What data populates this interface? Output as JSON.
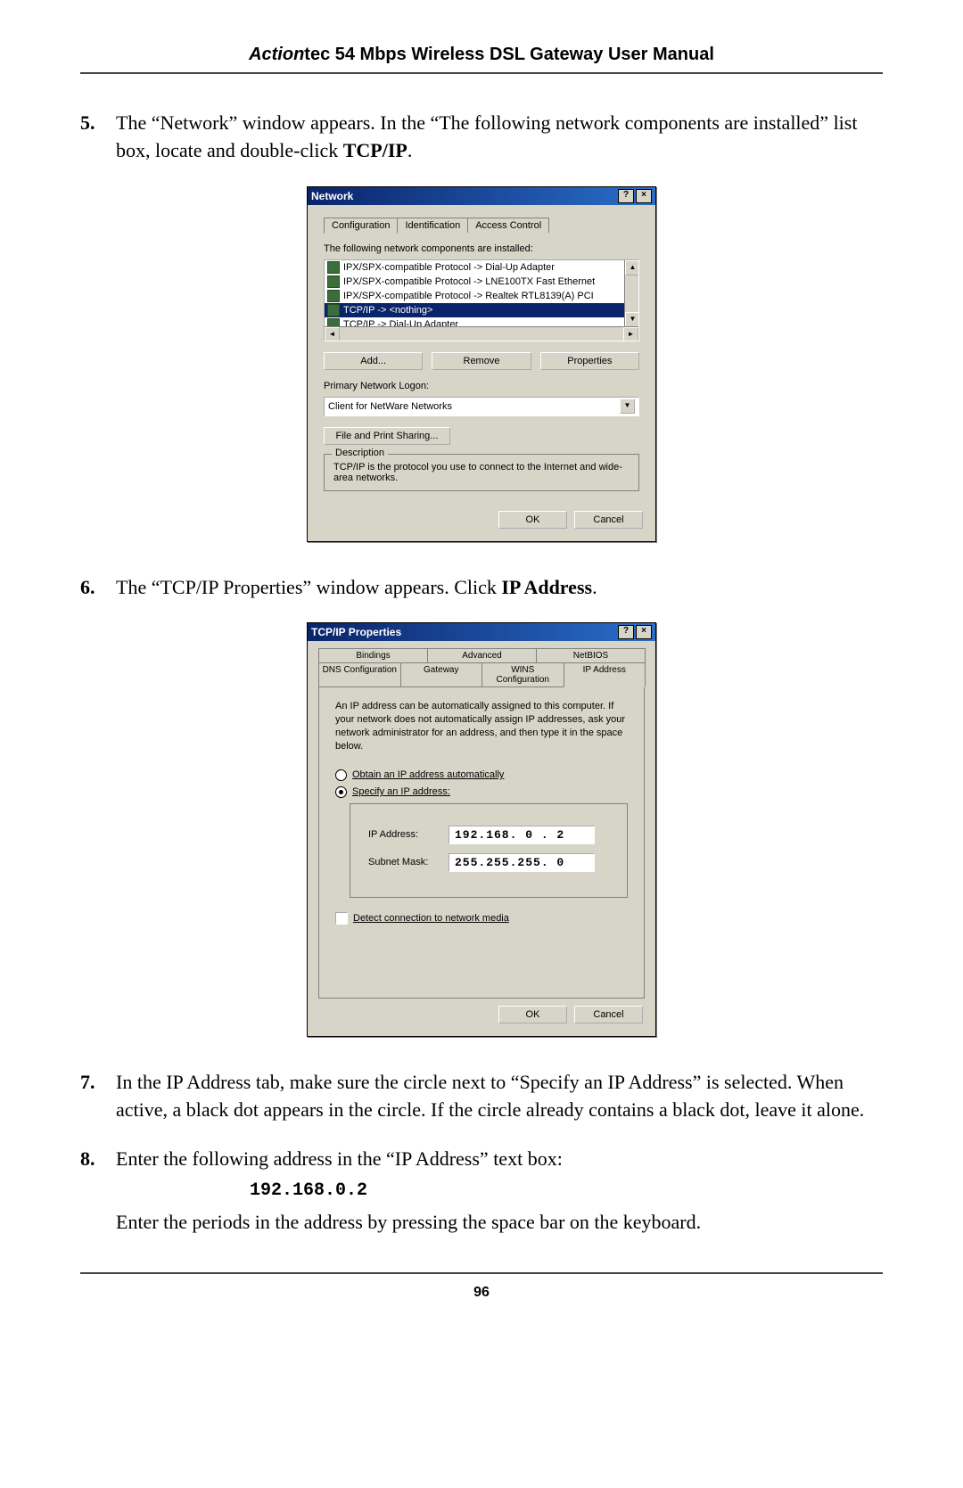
{
  "header": {
    "brand_italic": "Action",
    "brand_rest": "tec 54 Mbps Wireless DSL Gateway User Manual"
  },
  "steps": {
    "s5": {
      "num": "5.",
      "text_a": "The “Network” window appears. In the “The following network components are installed” list box, locate and double-click ",
      "bold": "TCP/IP",
      "text_b": "."
    },
    "s6": {
      "num": "6.",
      "text_a": "The “TCP/IP Properties” window appears. Click ",
      "bold": "IP Address",
      "text_b": "."
    },
    "s7": {
      "num": "7.",
      "text": "In the IP Address tab, make sure the circle next to “Specify an IP Address” is selected. When active, a black dot appears in the circle. If the circle already contains a black dot, leave it alone."
    },
    "s8": {
      "num": "8.",
      "text_a": "Enter the following address in the “IP Address” text box:",
      "addr": "192.168.0.2",
      "text_b": "Enter the periods in the address by pressing the space bar on the keyboard."
    }
  },
  "network_dialog": {
    "title": "Network",
    "help_btn": "?",
    "close_btn": "×",
    "tabs": {
      "config": "Configuration",
      "ident": "Identification",
      "access": "Access Control"
    },
    "components_label": "The following network components are installed:",
    "list": [
      "IPX/SPX-compatible Protocol -> Dial-Up Adapter",
      "IPX/SPX-compatible Protocol -> LNE100TX Fast Ethernet",
      "IPX/SPX-compatible Protocol -> Realtek RTL8139(A) PCI",
      "TCP/IP -> <nothing>",
      "TCP/IP -> Dial-Up Adapter"
    ],
    "btn_add": "Add...",
    "btn_remove": "Remove",
    "btn_props": "Properties",
    "primary_logon_label": "Primary Network Logon:",
    "primary_logon_value": "Client for NetWare Networks",
    "file_print": "File and Print Sharing...",
    "desc_title": "Description",
    "desc_text": "TCP/IP is the protocol you use to connect to the Internet and wide-area networks.",
    "ok": "OK",
    "cancel": "Cancel"
  },
  "tcpip_dialog": {
    "title": "TCP/IP Properties",
    "help_btn": "?",
    "close_btn": "×",
    "tabs_row1": {
      "bindings": "Bindings",
      "advanced": "Advanced",
      "netbios": "NetBIOS"
    },
    "tabs_row2": {
      "dns": "DNS Configuration",
      "gateway": "Gateway",
      "wins": "WINS Configuration",
      "ipaddr": "IP Address"
    },
    "desc": "An IP address can be automatically assigned to this computer. If your network does not automatically assign IP addresses, ask your network administrator for an address, and then type it in the space below.",
    "radio_auto": "Obtain an IP address automatically",
    "radio_spec": "Specify an IP address:",
    "ip_label": "IP Address:",
    "ip_value": "192.168. 0 . 2",
    "mask_label": "Subnet Mask:",
    "mask_value": "255.255.255. 0",
    "detect": "Detect connection to network media",
    "ok": "OK",
    "cancel": "Cancel"
  },
  "page_number": "96"
}
